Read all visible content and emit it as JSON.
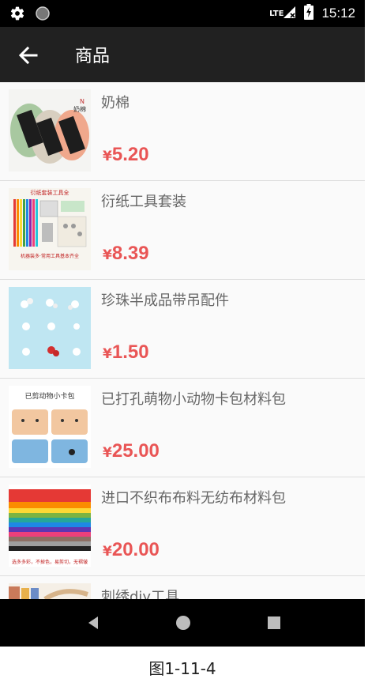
{
  "status_bar": {
    "time": "15:12",
    "network": "LTE"
  },
  "app_bar": {
    "title": "商品"
  },
  "products": [
    {
      "name": "奶棉",
      "currency": "¥",
      "price": "5.20"
    },
    {
      "name": "衍纸工具套装",
      "currency": "¥",
      "price": "8.39"
    },
    {
      "name": "珍珠半成品带吊配件",
      "currency": "¥",
      "price": "1.50"
    },
    {
      "name": "已打孔萌物小动物卡包材料包",
      "currency": "¥",
      "price": "25.00"
    },
    {
      "name": "进口不织布布料无纺布材料包",
      "currency": "¥",
      "price": "20.00"
    },
    {
      "name": "刺绣diy工具"
    }
  ],
  "thumb_text": {
    "yarn_brand": "奶棉",
    "quill_top": "衍纸套装工具全",
    "quill_bottom": "机器装多·常用工具基本齐全",
    "card_title": "已剪动物小卡包",
    "felt_bottom": "选多多彩，不掉色，易剪切，无褶皱"
  },
  "caption": "图1-11-4",
  "colors": {
    "app_bar": "#212121",
    "price": "#e95555",
    "status_bar": "#000000"
  }
}
